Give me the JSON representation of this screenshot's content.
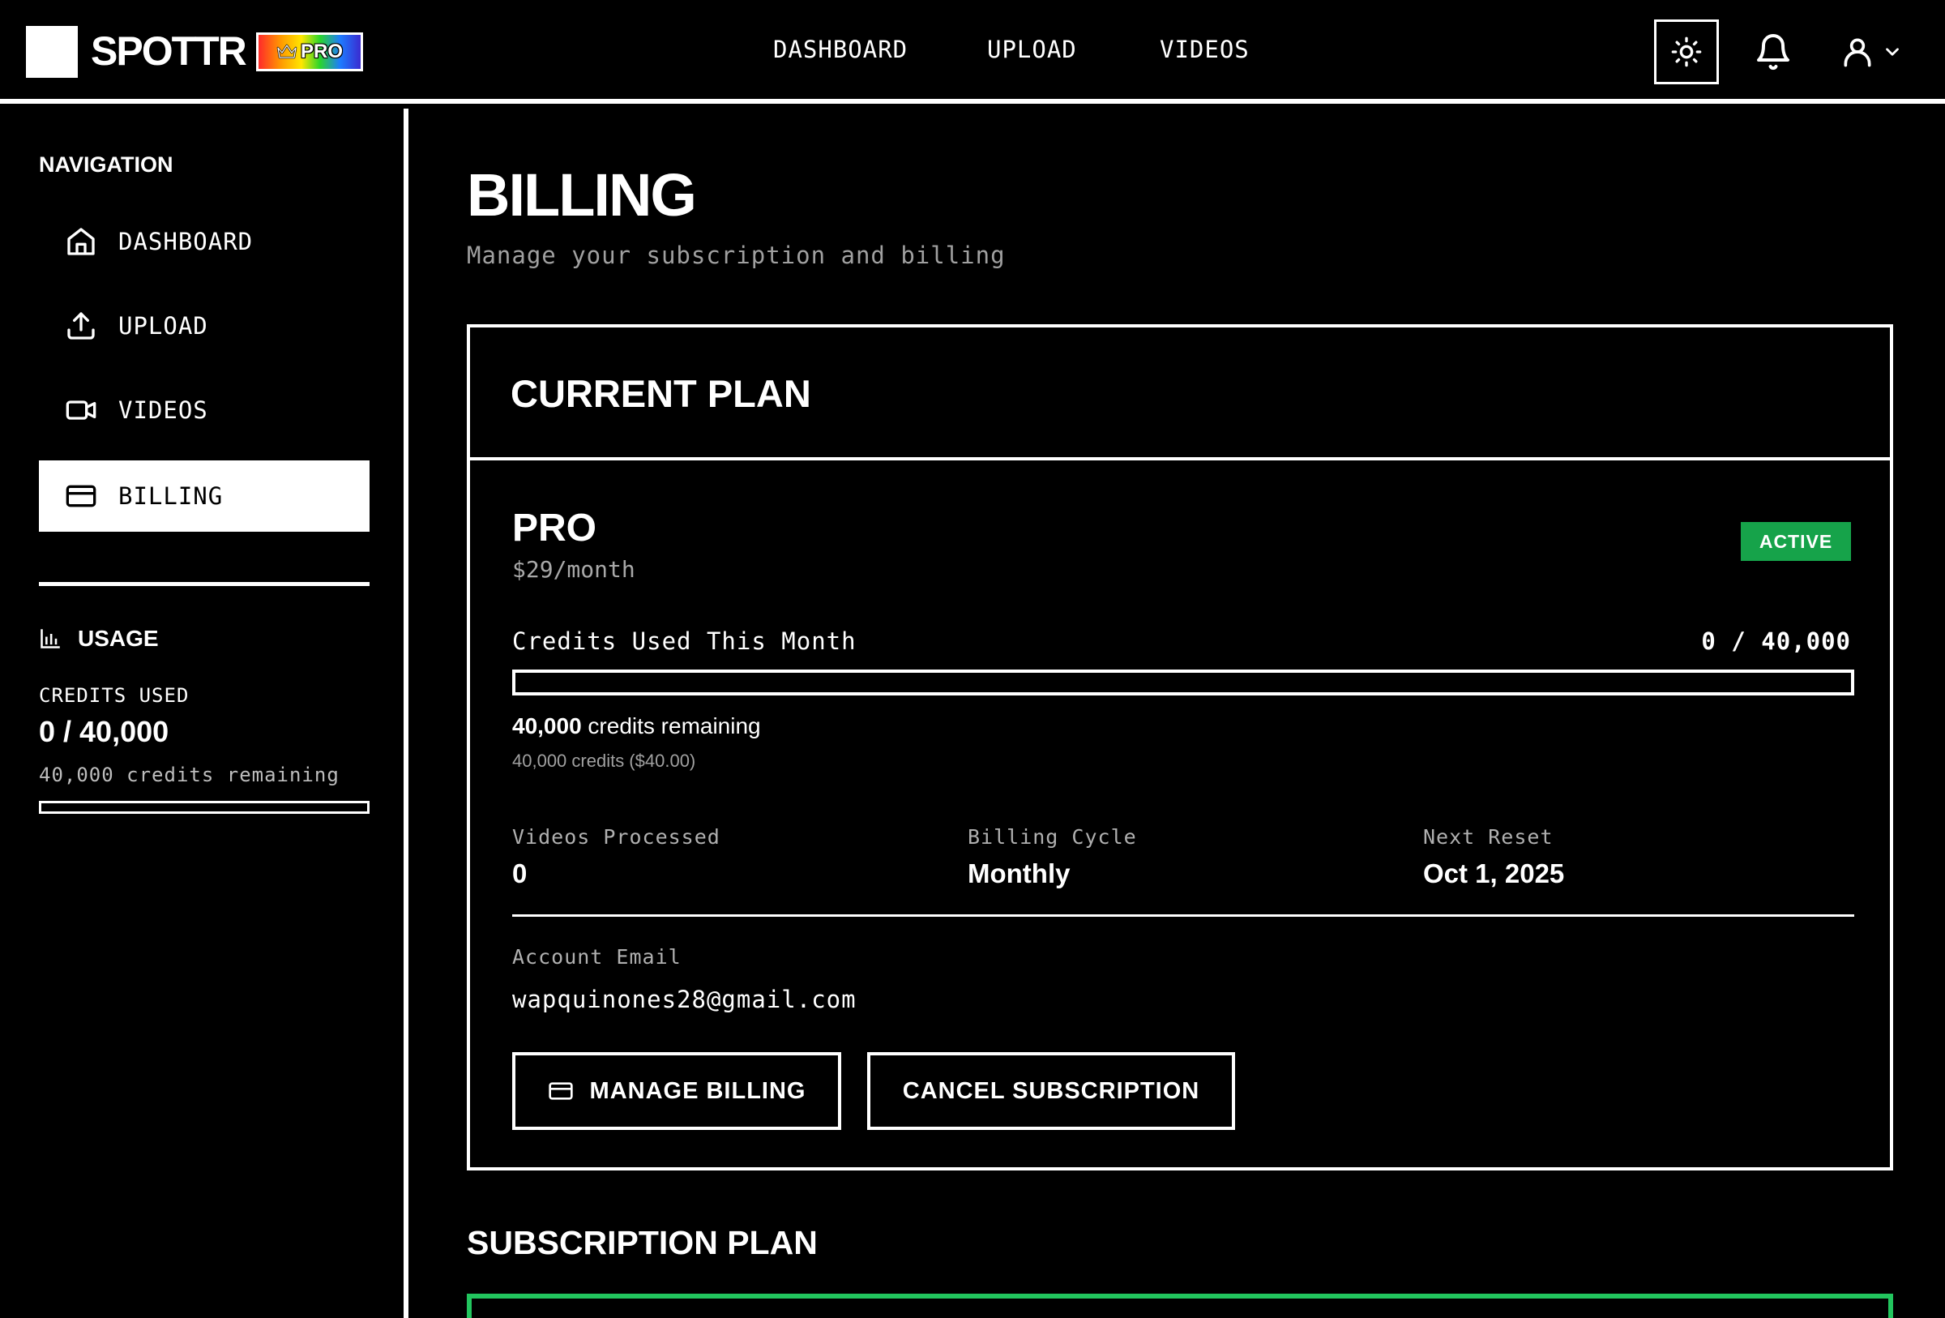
{
  "app": {
    "brand": "SPOTTR",
    "badge": "PRO"
  },
  "topnav": {
    "items": [
      "DASHBOARD",
      "UPLOAD",
      "VIDEOS"
    ]
  },
  "sidebar": {
    "heading": "NAVIGATION",
    "items": [
      {
        "label": "DASHBOARD",
        "icon": "home-icon"
      },
      {
        "label": "UPLOAD",
        "icon": "upload-icon"
      },
      {
        "label": "VIDEOS",
        "icon": "video-icon"
      },
      {
        "label": "BILLING",
        "icon": "credit-card-icon",
        "active": true
      }
    ],
    "usage": {
      "title": "USAGE",
      "credits_label": "CREDITS USED",
      "credits_value": "0 / 40,000",
      "remaining": "40,000 credits remaining",
      "used_fraction": 0
    }
  },
  "page": {
    "title": "BILLING",
    "subtitle": "Manage your subscription and billing"
  },
  "current_plan": {
    "heading": "CURRENT PLAN",
    "plan_name": "PRO",
    "price": "$29/month",
    "status": "ACTIVE",
    "usage_label": "Credits Used This Month",
    "usage_count": "0 / 40,000",
    "used_fraction": 0,
    "remaining_number": "40,000",
    "remaining_text": " credits remaining",
    "remaining_detail": "40,000 credits ($40.00)",
    "stats": [
      {
        "label": "Videos Processed",
        "value": "0"
      },
      {
        "label": "Billing Cycle",
        "value": "Monthly"
      },
      {
        "label": "Next Reset",
        "value": "Oct 1, 2025"
      }
    ],
    "email_label": "Account Email",
    "email": "wapquinones28@gmail.com",
    "manage_button": "MANAGE BILLING",
    "cancel_button": "CANCEL SUBSCRIPTION"
  },
  "subscription": {
    "heading": "SUBSCRIPTION PLAN"
  },
  "colors": {
    "accent_green": "#16a34a",
    "plan_border": "#22c55e",
    "background": "#000000",
    "foreground": "#ffffff"
  }
}
